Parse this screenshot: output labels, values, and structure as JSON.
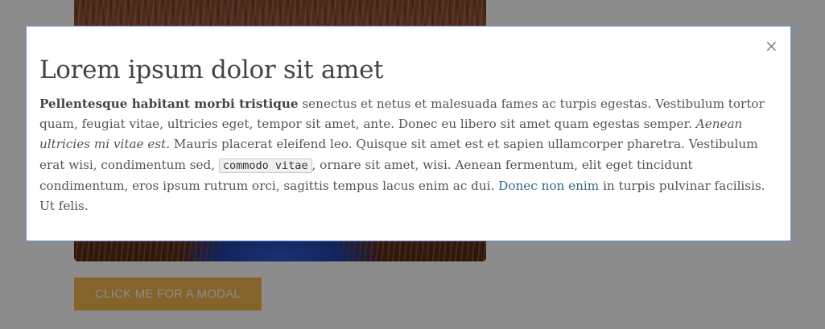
{
  "background": {
    "cta_button_label": "CLICK ME FOR A MODAL"
  },
  "modal": {
    "close_icon": "×",
    "title": "Lorem ipsum dolor sit amet",
    "body": {
      "bold_lead": "Pellentesque habitant morbi tristique",
      "text_1": " senectus et netus et malesuada fames ac turpis egestas. Vestibulum tortor quam, feugiat vitae, ultricies eget, tempor sit amet, ante. Donec eu libero sit amet quam egestas semper. ",
      "italic": "Aenean ultricies mi vitae est.",
      "text_2": " Mauris placerat eleifend leo. Quisque sit amet est et sapien ullamcorper pharetra. Vestibulum erat wisi, condimentum sed, ",
      "code": "commodo vitae",
      "text_3": ", ornare sit amet, wisi. Aenean fermentum, elit eget tincidunt condimentum, eros ipsum rutrum orci, sagittis tempus lacus enim ac dui. ",
      "link": "Donec non enim",
      "text_4": " in turpis pulvinar facilisis. Ut felis."
    }
  },
  "colors": {
    "overlay": "rgba(0,0,0,0.45)",
    "modal_border": "#6f93d6",
    "button_bg": "#f0b74e",
    "link": "#2b6a8a"
  }
}
